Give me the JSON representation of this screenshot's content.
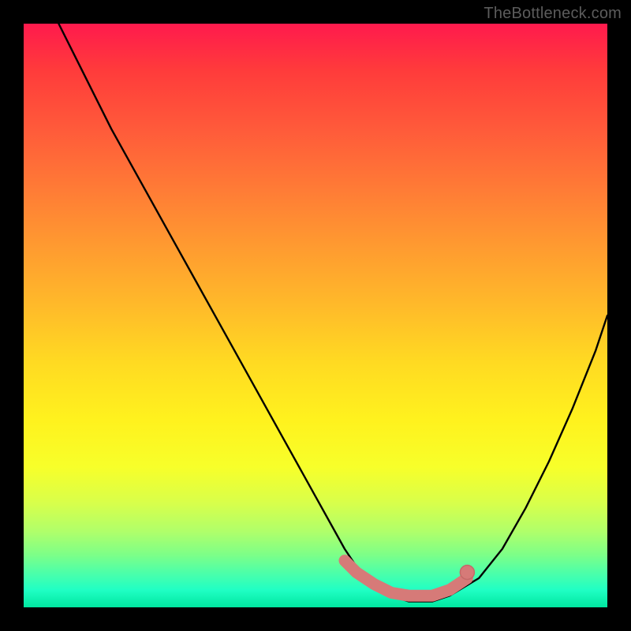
{
  "watermark": "TheBottleneck.com",
  "colors": {
    "frame": "#000000",
    "curve": "#000000",
    "marker": "#d67a78",
    "marker_stroke": "#c46a68"
  },
  "chart_data": {
    "type": "line",
    "title": "",
    "xlabel": "",
    "ylabel": "",
    "xlim": [
      0,
      100
    ],
    "ylim": [
      0,
      100
    ],
    "grid": false,
    "series": [
      {
        "name": "bottleneck-curve",
        "x": [
          6,
          10,
          15,
          20,
          25,
          30,
          35,
          40,
          45,
          50,
          55,
          57,
          60,
          63,
          66,
          70,
          73,
          78,
          82,
          86,
          90,
          94,
          98,
          100
        ],
        "y": [
          100,
          92,
          82,
          73,
          64,
          55,
          46,
          37,
          28,
          19,
          10,
          7,
          4,
          2,
          1,
          1,
          2,
          5,
          10,
          17,
          25,
          34,
          44,
          50
        ]
      }
    ],
    "highlight_region": {
      "name": "optimal-band",
      "x": [
        55,
        57,
        60,
        63,
        66,
        70,
        73,
        76
      ],
      "y": [
        8,
        6,
        4,
        2.5,
        2,
        2,
        3,
        5
      ]
    },
    "end_marker": {
      "x": 76,
      "y": 6
    }
  }
}
